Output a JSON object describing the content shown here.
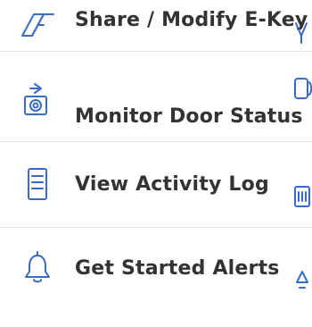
{
  "colors": {
    "accent": "#3a69c6",
    "text": "#333333",
    "divider": "#e6e6e6"
  },
  "menu": {
    "items": [
      {
        "label": "Share / Modify E-Key",
        "icon": "key-share-icon"
      },
      {
        "label": "Monitor Door Status",
        "icon": "door-sensor-icon"
      },
      {
        "label": "View Activity Log",
        "icon": "log-list-icon"
      },
      {
        "label": "Get Started Alerts",
        "icon": "alert-bell-icon"
      }
    ]
  },
  "edge_icons": [
    "key-outline-icon",
    "door-sensor-outline-icon",
    "log-outline-icon",
    "bell-outline-icon"
  ]
}
